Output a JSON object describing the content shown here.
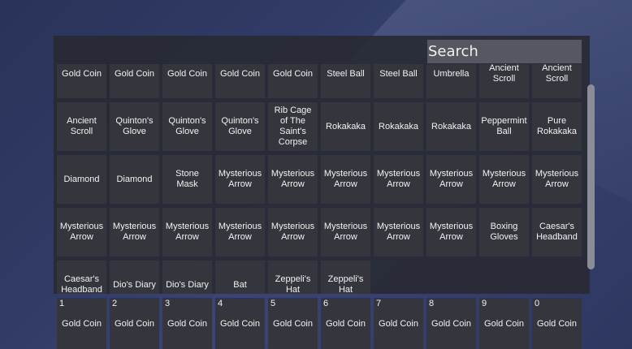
{
  "search": {
    "placeholder": "Search"
  },
  "inventory": [
    "Gold Coin",
    "Gold Coin",
    "Gold Coin",
    "Gold Coin",
    "Gold Coin",
    "Steel Ball",
    "Steel Ball",
    "Umbrella",
    "Ancient Scroll",
    "Ancient Scroll",
    "Ancient Scroll",
    "Quinton's Glove",
    "Quinton's Glove",
    "Quinton's Glove",
    "Rib Cage of The Saint's Corpse",
    "Rokakaka",
    "Rokakaka",
    "Rokakaka",
    "Peppermint Ball",
    "Pure Rokakaka",
    "Diamond",
    "Diamond",
    "Stone Mask",
    "Mysterious Arrow",
    "Mysterious Arrow",
    "Mysterious Arrow",
    "Mysterious Arrow",
    "Mysterious Arrow",
    "Mysterious Arrow",
    "Mysterious Arrow",
    "Mysterious Arrow",
    "Mysterious Arrow",
    "Mysterious Arrow",
    "Mysterious Arrow",
    "Mysterious Arrow",
    "Mysterious Arrow",
    "Mysterious Arrow",
    "Mysterious Arrow",
    "Boxing Gloves",
    "Caesar's Headband",
    "Caesar's Headband",
    "Dio's Diary",
    "Dio's Diary",
    "Bat",
    "Zeppeli's Hat",
    "Zeppeli's Hat"
  ],
  "hotbar": [
    {
      "key": "1",
      "item": "Gold Coin"
    },
    {
      "key": "2",
      "item": "Gold Coin"
    },
    {
      "key": "3",
      "item": "Gold Coin"
    },
    {
      "key": "4",
      "item": "Gold Coin"
    },
    {
      "key": "5",
      "item": "Gold Coin"
    },
    {
      "key": "6",
      "item": "Gold Coin"
    },
    {
      "key": "7",
      "item": "Gold Coin"
    },
    {
      "key": "8",
      "item": "Gold Coin"
    },
    {
      "key": "9",
      "item": "Gold Coin"
    },
    {
      "key": "0",
      "item": "Gold Coin"
    }
  ]
}
